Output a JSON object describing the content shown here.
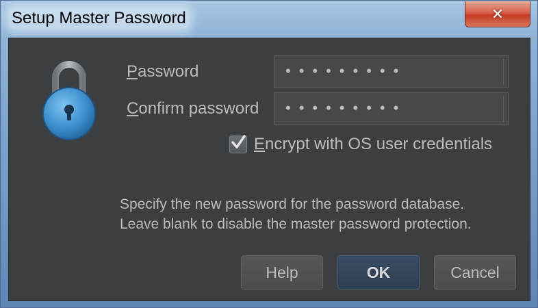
{
  "window": {
    "title": "Setup Master Password",
    "close_label": "✕"
  },
  "form": {
    "password_label_mnemonic": "P",
    "password_label_rest": "assword",
    "password_value": "•••••••••",
    "confirm_label_mnemonic": "C",
    "confirm_label_rest": "onfirm password",
    "confirm_value": "•••••••••"
  },
  "options": {
    "encrypt_checked": true,
    "encrypt_label_mnemonic": "E",
    "encrypt_label_rest": "ncrypt with OS user credentials"
  },
  "info": {
    "line1": "Specify the new password for the password database.",
    "line2": "Leave blank to disable the master password protection."
  },
  "buttons": {
    "help": "Help",
    "ok": "OK",
    "cancel": "Cancel"
  },
  "icons": {
    "lock": "lock-icon",
    "check": "checkmark-icon",
    "close": "close-icon"
  },
  "colors": {
    "dialog_bg": "#3c3f41",
    "text": "#bbbbbb",
    "lock_body": "#3e8fce",
    "close_button": "#c43b25"
  }
}
